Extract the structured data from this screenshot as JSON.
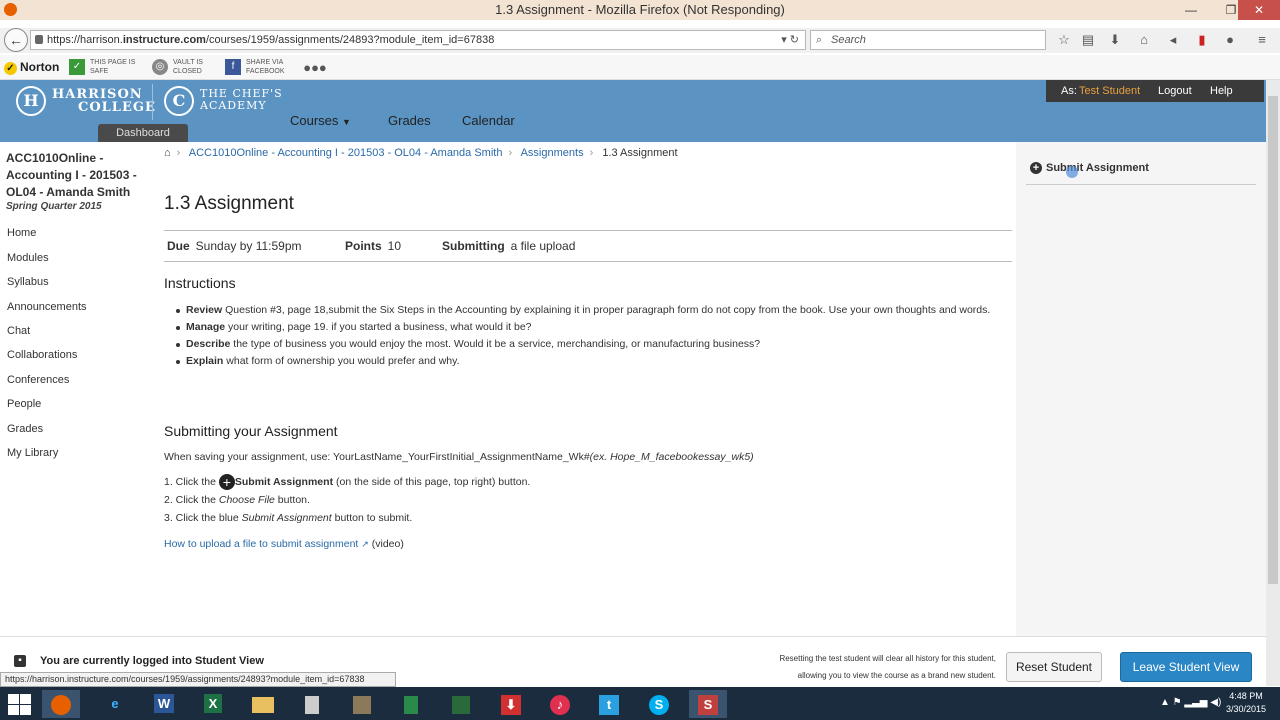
{
  "browser": {
    "title": "1.3 Assignment - Mozilla Firefox (Not Responding)",
    "url_prefix": "https://harrison.",
    "url_domain": "instructure.com",
    "url_suffix": "/courses/1959/assignments/24893?module_item_id=67838",
    "search_placeholder": "Search",
    "status_url": "https://harrison.instructure.com/courses/1959/assignments/24893?module_item_id=67838"
  },
  "addons": {
    "norton": "Norton",
    "safe_line1": "THIS PAGE IS",
    "safe_line2": "SAFE",
    "vault_line1": "VAULT IS",
    "vault_line2": "CLOSED",
    "share_line1": "SHARE VIA",
    "share_line2": "FACEBOOK"
  },
  "header": {
    "logo1_line1": "HARRISON",
    "logo1_line2": "COLLEGE",
    "logo2_line1": "THE CHEF'S",
    "logo2_line2": "ACADEMY",
    "dashboard": "Dashboard",
    "nav": [
      "Courses",
      "Grades",
      "Calendar"
    ],
    "as_label": "As:",
    "user": "Test Student",
    "logout": "Logout",
    "help": "Help"
  },
  "sidebar": {
    "course_title": "ACC1010Online - Accounting I - 201503 - OL04 - Amanda Smith",
    "quarter": "Spring Quarter 2015",
    "items": [
      "Home",
      "Modules",
      "Syllabus",
      "Announcements",
      "Chat",
      "Collaborations",
      "Conferences",
      "People",
      "Grades",
      "My Library"
    ]
  },
  "breadcrumb": {
    "course": "ACC1010Online - Accounting I - 201503 - OL04 - Amanda Smith",
    "section": "Assignments",
    "current": "1.3 Assignment"
  },
  "assignment": {
    "title": "1.3 Assignment",
    "due_label": "Due",
    "due_value": "Sunday by 11:59pm",
    "points_label": "Points",
    "points_value": "10",
    "submitting_label": "Submitting",
    "submitting_value": "a file upload",
    "instructions_heading": "Instructions",
    "bullets": [
      {
        "bold": "Review",
        "text": " Question #3, page 18,submit the Six Steps in the Accounting by explaining it in proper paragraph form do not copy from the book. Use your own thoughts and words."
      },
      {
        "bold": "Manage",
        "text": " your writing, page 19. if you started a business, what would it be?"
      },
      {
        "bold": "Describe",
        "text": " the type of business you would enjoy the most. Would  it be a service, merchandising, or manufacturing business?"
      },
      {
        "bold": "Explain",
        "text": " what form of ownership you would prefer and why."
      }
    ],
    "submitting_heading": "Submitting your Assignment",
    "save_text": "When saving your assignment, use: YourLastName_YourFirstInitial_AssignmentName_Wk#",
    "save_example": "(ex. Hope_M_facebookessay_wk5)",
    "step1_a": "1. Click the ",
    "step1_b": "Submit Assignment",
    "step1_c": " (on the side of this page, top right) button.",
    "step2_a": "2. Click the ",
    "step2_b": "Choose File",
    "step2_c": " button.",
    "step3_a": "3. Click the blue ",
    "step3_b": "Submit Assignment",
    "step3_c": " button to submit.",
    "video_link": "How to upload a file to submit assignment",
    "video_suffix": "(video)"
  },
  "right": {
    "submit_assignment": "Submit Assignment"
  },
  "footer": {
    "banner": "You are currently logged into Student View",
    "reset_note_1": "Resetting the test student will clear all history for this student,",
    "reset_note_2": "allowing you to view the course as a brand new student.",
    "reset_button": "Reset Student",
    "leave_button": "Leave Student View"
  },
  "taskbar": {
    "time": "4:48 PM",
    "date": "3/30/2015"
  },
  "colors": {
    "header_blue": "#5b93c3",
    "link_blue": "#2a6aa8",
    "leave_button": "#2b86c5",
    "user_orange": "#e8a040"
  }
}
